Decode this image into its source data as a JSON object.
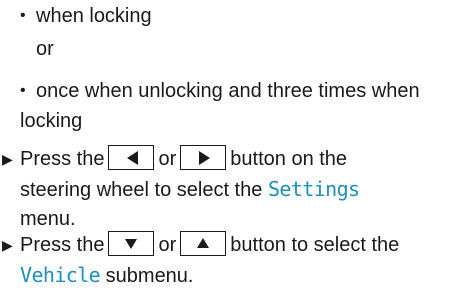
{
  "bullets": [
    {
      "text": "when locking"
    },
    {
      "text": "once when unlocking and three times when",
      "continuation": "locking"
    }
  ],
  "or_text": "or",
  "steps": [
    {
      "before": "Press the",
      "key1": "left-arrow-key",
      "middle": "or",
      "key2": "right-arrow-key",
      "after_key": "button on the",
      "line2_before": "steering wheel to select the",
      "menu_name": "Settings",
      "line3": "menu."
    },
    {
      "before": "Press the",
      "key1": "down-arrow-key",
      "middle": "or",
      "key2": "up-arrow-key",
      "after_key": "button to select the",
      "menu_name": "Vehicle",
      "after_menu": "submenu."
    }
  ],
  "colors": {
    "text": "#1a1a1a",
    "display_term": "#1d8fc1"
  }
}
